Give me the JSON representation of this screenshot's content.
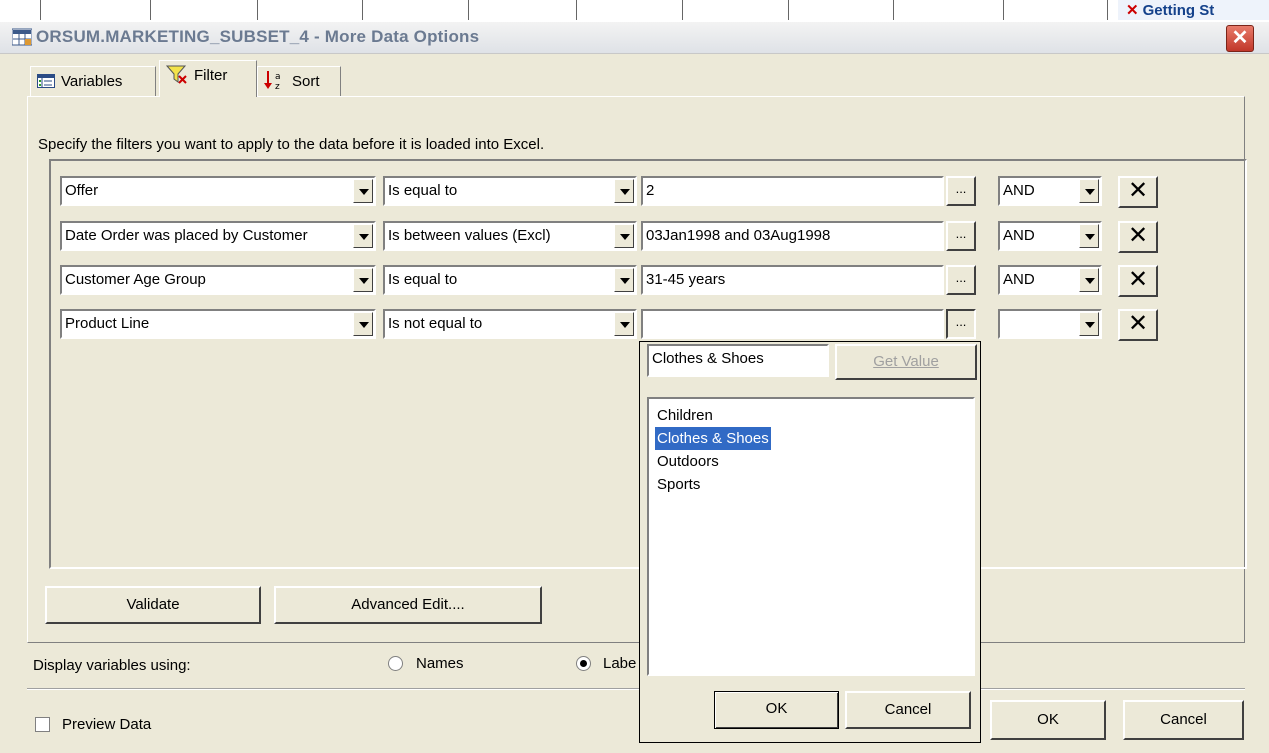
{
  "excel": {
    "right_text": "Getting St"
  },
  "window": {
    "title": "ORSUM.MARKETING_SUBSET_4 - More Data Options",
    "close_symbol": "✕"
  },
  "tabs": [
    {
      "label": "Variables",
      "icon": "table-icon"
    },
    {
      "label": "Filter",
      "icon": "funnel-icon",
      "active": true
    },
    {
      "label": "Sort",
      "icon": "sort-az-icon"
    }
  ],
  "instructions": "Specify the filters you want to apply to the data before it is loaded into Excel.",
  "filters": [
    {
      "variable": "Offer",
      "operator": "Is equal to",
      "value": "2",
      "connector": "AND"
    },
    {
      "variable": "Date Order was placed by Customer",
      "operator": "Is between values (Excl)",
      "value": "03Jan1998 and 03Aug1998",
      "connector": "AND"
    },
    {
      "variable": "Customer Age Group",
      "operator": "Is equal to",
      "value": "31-45 years",
      "connector": "AND"
    },
    {
      "variable": "Product Line",
      "operator": "Is not equal to",
      "value": "",
      "connector": ""
    }
  ],
  "row_buttons": {
    "ellipsis": "...",
    "delete": "✕"
  },
  "buttons": {
    "validate": "Validate",
    "advanced_edit": "Advanced Edit...."
  },
  "display": {
    "label": "Display variables using:",
    "names_label": "Names",
    "labels_label": "Labe",
    "selected": "labels"
  },
  "preview": {
    "label": "Preview Data",
    "checked": false
  },
  "footer": {
    "ok": "OK",
    "cancel": "Cancel"
  },
  "popup": {
    "input_value": "Clothes & Shoes",
    "get_value_label": "Get Value",
    "items": [
      "Children",
      "Clothes & Shoes",
      "Outdoors",
      "Sports"
    ],
    "selected_item": "Clothes & Shoes",
    "ok": "OK",
    "cancel": "Cancel"
  }
}
